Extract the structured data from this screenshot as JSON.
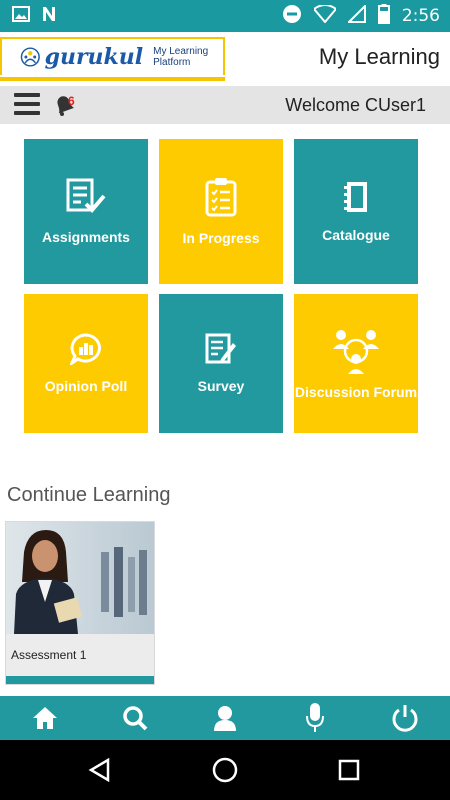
{
  "status_bar": {
    "time": "2:56",
    "icons_left": [
      "gallery-icon",
      "n-icon"
    ],
    "icons_right": [
      "do-not-disturb-icon",
      "wifi-icon",
      "signal-icon",
      "battery-icon"
    ]
  },
  "header": {
    "logo_brand": "gurukul",
    "logo_tagline": "My Learning Platform",
    "title": "My Learning"
  },
  "toolbar": {
    "welcome": "Welcome CUser1",
    "notification_count": "6"
  },
  "tiles": [
    {
      "label": "Assignments",
      "color": "#21999f",
      "icon": "assignment-icon"
    },
    {
      "label": "In Progress",
      "color": "#fdcb00",
      "icon": "clipboard-checklist-icon"
    },
    {
      "label": "Catalogue",
      "color": "#21999f",
      "icon": "notebook-icon"
    },
    {
      "label": "Opinion Poll",
      "color": "#fdcb00",
      "icon": "chat-chart-icon"
    },
    {
      "label": "Survey",
      "color": "#21999f",
      "icon": "survey-icon"
    },
    {
      "label": "Discussion Forum",
      "color": "#fdcb00",
      "icon": "group-discussion-icon"
    }
  ],
  "continue_learning": {
    "title": "Continue Learning",
    "items": [
      {
        "label": "Assessment 1"
      }
    ]
  },
  "bottom_nav": {
    "items": [
      "home-icon",
      "search-icon",
      "profile-icon",
      "microphone-icon",
      "power-icon"
    ]
  },
  "colors": {
    "teal": "#21999f",
    "yellow": "#fdcb00",
    "status_bar": "#1a9aa0"
  }
}
